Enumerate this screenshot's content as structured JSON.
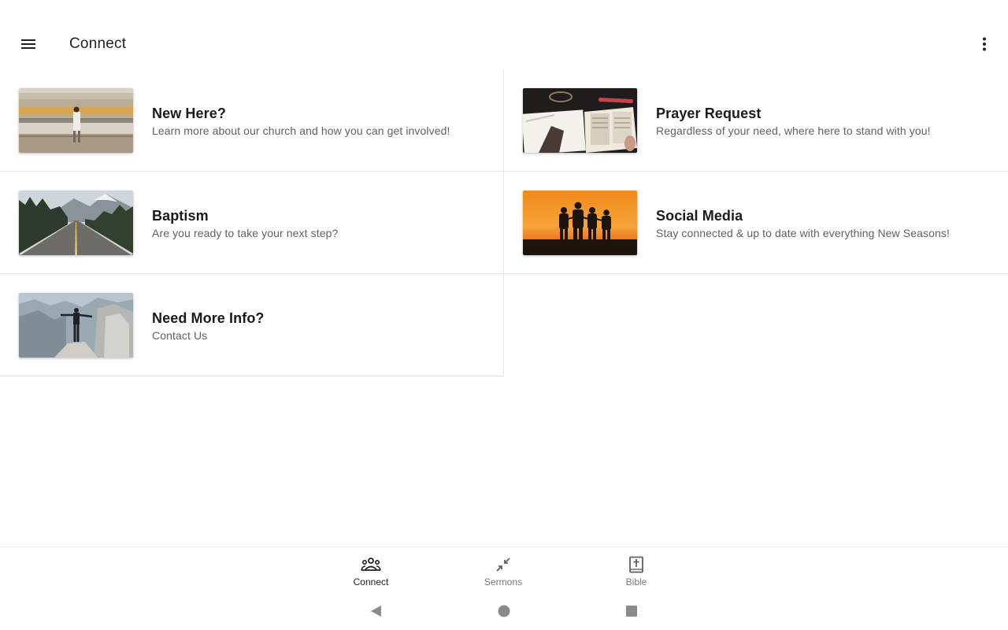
{
  "appbar": {
    "title": "Connect",
    "menu_icon": "hamburger-menu-icon",
    "overflow_icon": "more-vertical-icon"
  },
  "cards": [
    {
      "title": "New Here?",
      "subtitle": "Learn more about our church and how you can get involved!",
      "image": "train-station-photo"
    },
    {
      "title": "Prayer Request",
      "subtitle": "Regardless of your need, where here to stand with you!",
      "image": "bible-journal-photo"
    },
    {
      "title": "Baptism",
      "subtitle": "Are you ready to take your next step?",
      "image": "mountain-road-photo"
    },
    {
      "title": "Social Media",
      "subtitle": "Stay connected & up to date with everything New Seasons!",
      "image": "sunset-silhouettes-photo"
    },
    {
      "title": "Need More Info?",
      "subtitle": "Contact Us",
      "image": "cliff-person-photo"
    }
  ],
  "bottom_nav": {
    "items": [
      {
        "label": "Connect",
        "icon": "people-group-icon",
        "active": true
      },
      {
        "label": "Sermons",
        "icon": "arrows-inward-icon",
        "active": false
      },
      {
        "label": "Bible",
        "icon": "book-cross-icon",
        "active": false
      }
    ]
  },
  "system_nav": {
    "back_icon": "back-triangle-icon",
    "home_icon": "home-circle-icon",
    "recents_icon": "recents-square-icon"
  },
  "colors": {
    "divider": "#e6e6e6",
    "text_primary": "#212121",
    "text_secondary": "#616161",
    "nav_inactive": "#757575"
  }
}
